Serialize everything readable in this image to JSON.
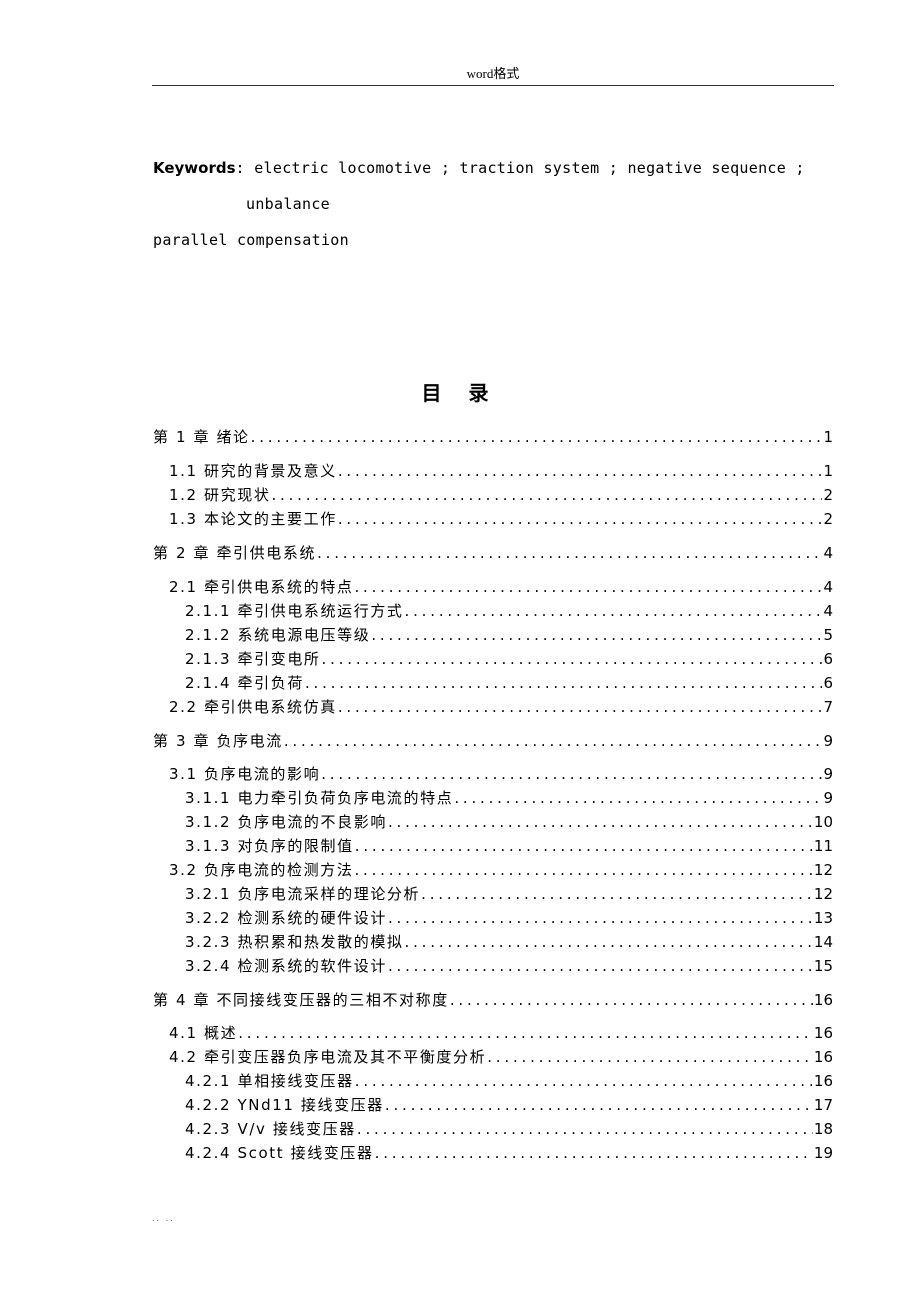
{
  "header": {
    "text": "word格式"
  },
  "keywords": {
    "label": "Keywords",
    "line1": ": electric locomotive ; traction system ; negative sequence ;",
    "line2": "unbalance",
    "line3": "parallel compensation"
  },
  "toc": {
    "title": "目 录",
    "entries": [
      {
        "label": "第 1 章   绪论",
        "page": "1",
        "level": 0
      },
      {
        "label": "1.1 研究的背景及意义 ",
        "page": "1",
        "level": 1
      },
      {
        "label": "1.2 研究现状 ",
        "page": "2",
        "level": 1
      },
      {
        "label": "1.3 本论文的主要工作 ",
        "page": "2",
        "level": 1
      },
      {
        "label": "第 2 章   牵引供电系统",
        "page": "4",
        "level": 0
      },
      {
        "label": "2.1 牵引供电系统的特点 ",
        "page": "4",
        "level": 1
      },
      {
        "label": "2.1.1 牵引供电系统运行方式",
        "page": "4",
        "level": 2
      },
      {
        "label": "2.1.2 系统电源电压等级",
        "page": "5",
        "level": 2
      },
      {
        "label": "2.1.3 牵引变电所",
        "page": "6",
        "level": 2
      },
      {
        "label": "2.1.4 牵引负荷",
        "page": "6",
        "level": 2
      },
      {
        "label": "2.2 牵引供电系统仿真 ",
        "page": "7",
        "level": 1
      },
      {
        "label": "第 3 章   负序电流",
        "page": "9",
        "level": 0
      },
      {
        "label": "3.1 负序电流的影响 ",
        "page": "9",
        "level": 1
      },
      {
        "label": "3.1.1 电力牵引负荷负序电流的特点",
        "page": "9",
        "level": 2
      },
      {
        "label": "3.1.2 负序电流的不良影响",
        "page": "10",
        "level": 2
      },
      {
        "label": "3.1.3 对负序的限制值",
        "page": "11",
        "level": 2
      },
      {
        "label": "3.2 负序电流的检测方法 ",
        "page": "12",
        "level": 1
      },
      {
        "label": "3.2.1  负序电流采样的理论分析 ",
        "page": "12",
        "level": 2
      },
      {
        "label": "3.2.2 检测系统的硬件设计",
        "page": "13",
        "level": 2
      },
      {
        "label": "3.2.3 热积累和热发散的模拟",
        "page": "14",
        "level": 2
      },
      {
        "label": "3.2.4 检测系统的软件设计",
        "page": "15",
        "level": 2
      },
      {
        "label": "第 4 章   不同接线变压器的三相不对称度",
        "page": "16",
        "level": 0
      },
      {
        "label": "4.1 概述 ",
        "page": "16",
        "level": 1
      },
      {
        "label": "4.2 牵引变压器负序电流及其不平衡度分析 ",
        "page": "16",
        "level": 1
      },
      {
        "label": "4.2.1  单相接线变压器 ",
        "page": "16",
        "level": 2
      },
      {
        "label": "4.2.2   YNd11 接线变压器",
        "page": "17",
        "level": 2
      },
      {
        "label": "4.2.3   V/v 接线变压器",
        "page": "18",
        "level": 2
      },
      {
        "label": "4.2.4   Scott 接线变压器",
        "page": "19",
        "level": 2
      }
    ]
  },
  "footer": {
    "text": ".. .."
  }
}
